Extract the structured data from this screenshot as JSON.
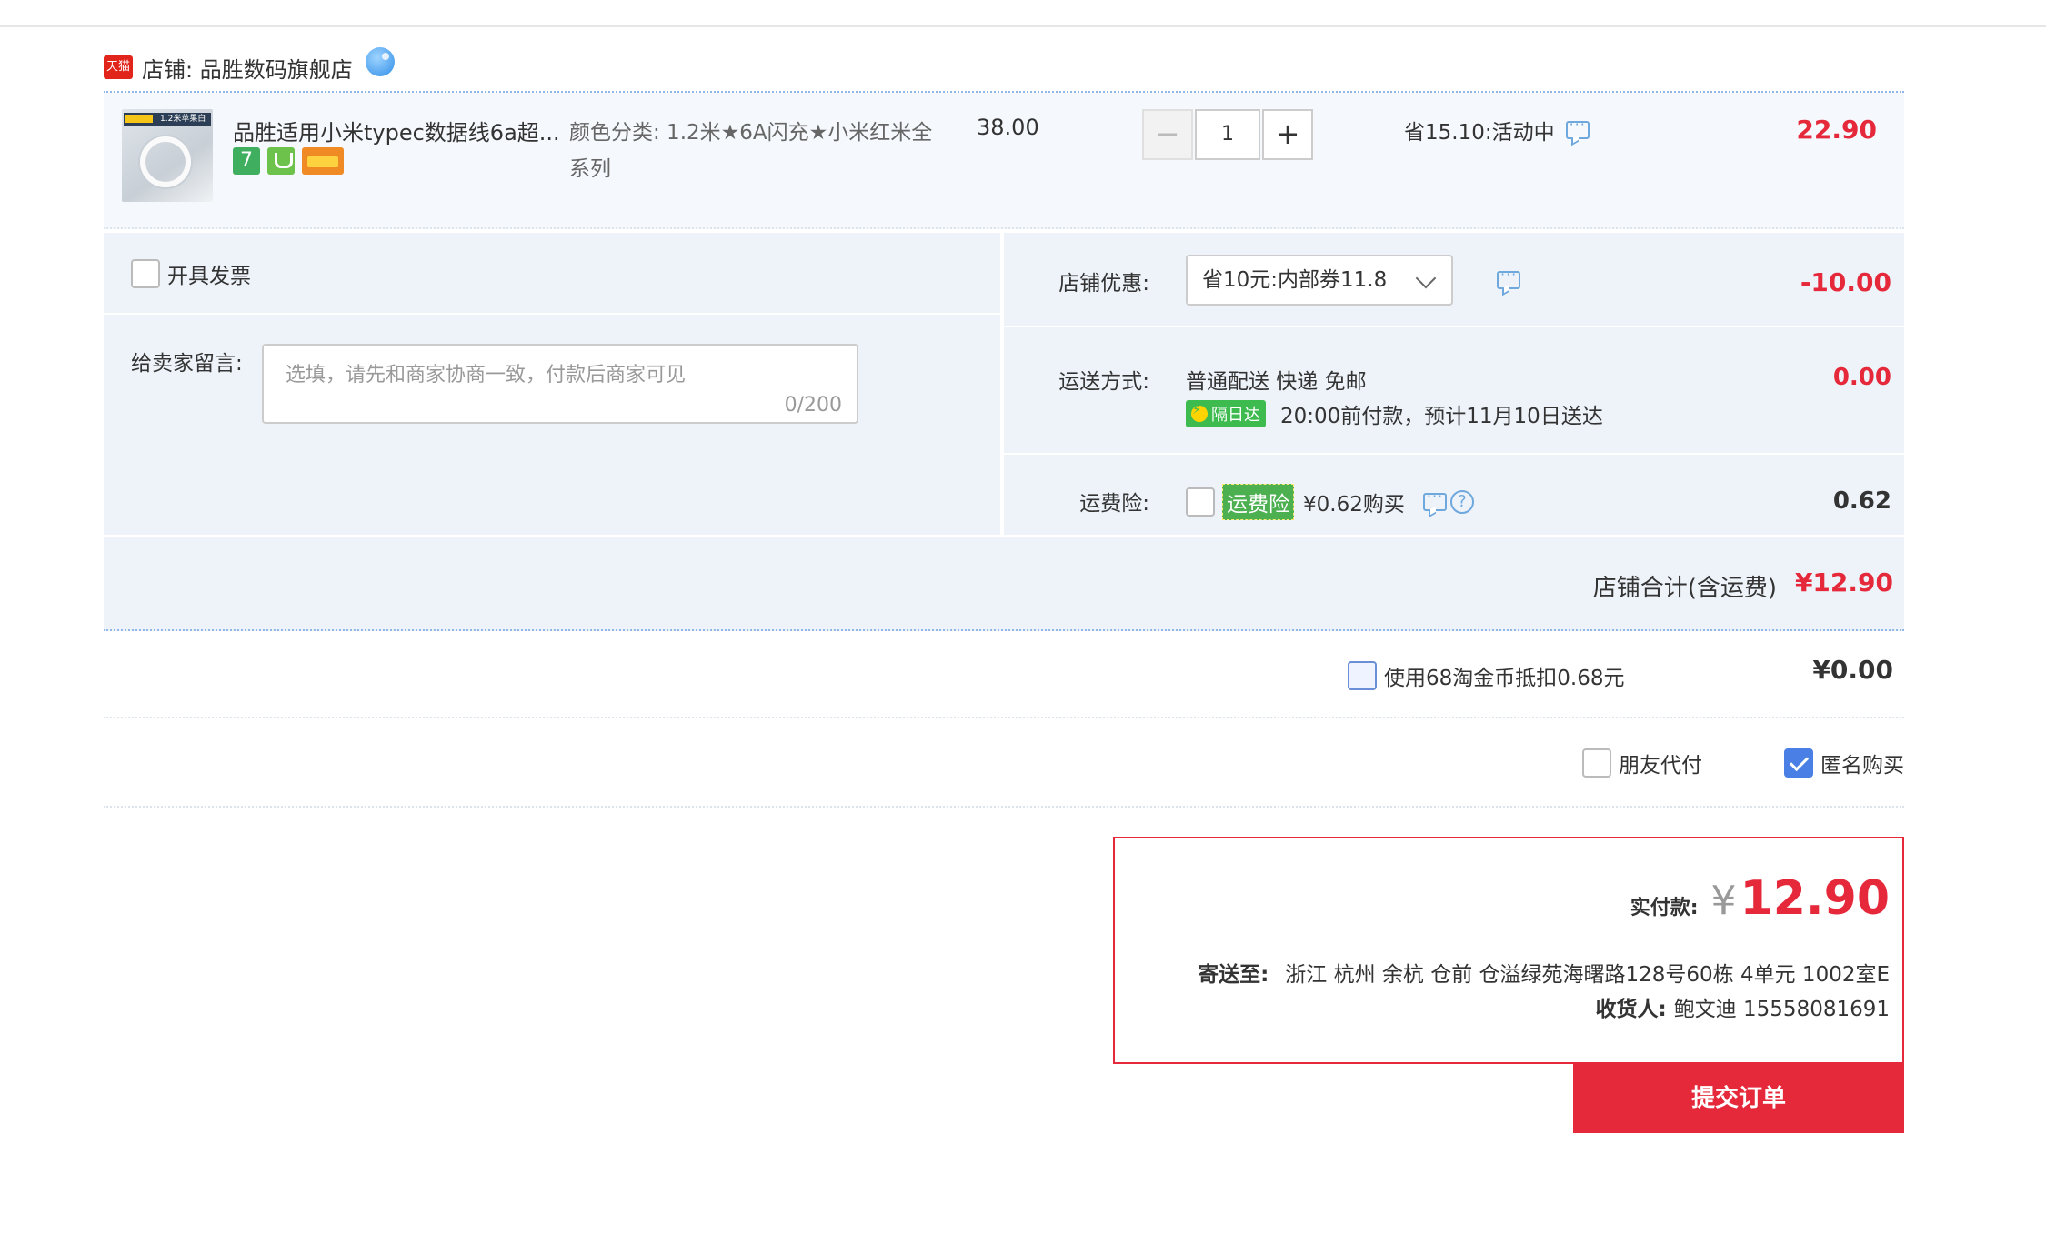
{
  "shop": {
    "badge": "天猫",
    "name": "店铺: 品胜数码旗舰店"
  },
  "item": {
    "thumb_text": "1.2米苹果白",
    "title": "品胜适用小米typec数据线6a超...",
    "badge_7": "7",
    "sku": "颜色分类: 1.2米★6A闪充★小米红米全系列",
    "unit_price": "38.00",
    "qty_minus": "−",
    "qty_value": "1",
    "qty_plus": "+",
    "promo": "省15.10:活动中",
    "total": "22.90"
  },
  "options": {
    "invoice_label": "开具发票",
    "message_label": "给卖家留言:",
    "message_placeholder": "选填，请先和商家协商一致，付款后商家可见",
    "message_count": "0/200",
    "coupon_label": "店铺优惠:",
    "coupon_value": "省10元:内部券11.8",
    "coupon_amount": "-10.00",
    "ship_label": "运送方式:",
    "ship_method": "普通配送 快递 免邮",
    "ship_badge": "隔日达",
    "ship_eta": "20:00前付款，预计11月10日送达",
    "ship_amount": "0.00",
    "insurance_label": "运费险:",
    "insurance_tag": "运费险",
    "insurance_text": "¥0.62购买",
    "insurance_help": "?",
    "insurance_amount": "0.62"
  },
  "store_total": {
    "label": "店铺合计(含运费)",
    "amount": "¥12.90"
  },
  "coin": {
    "label": "使用68淘金币抵扣0.68元",
    "amount": "¥0.00"
  },
  "pay_options": {
    "friend_pay": "朋友代付",
    "anonymous": "匿名购买"
  },
  "summary": {
    "pay_label": "实付款:",
    "currency": "¥",
    "pay_amount": "12.90",
    "address_label": "寄送至:",
    "address": "浙江 杭州 余杭 仓前 仓溢绿苑海曙路128号60栋 4单元 1002室E",
    "receiver_label": "收货人:",
    "receiver": "鲍文迪 15558081691"
  },
  "submit_label": "提交订单",
  "colors": {
    "accent_red": "#e5283a",
    "panel_bg": "#eef3fa",
    "link_blue": "#6fa8dc"
  }
}
